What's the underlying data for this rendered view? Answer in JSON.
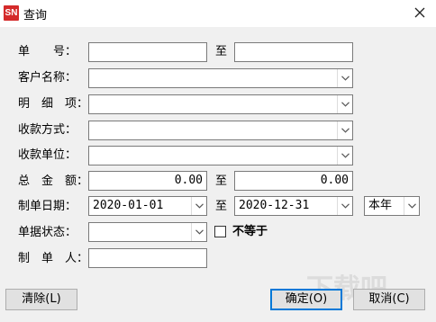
{
  "window": {
    "title": "查询",
    "app_icon_text": "SN"
  },
  "form": {
    "doc_no": {
      "label": "单　　号：",
      "from": "",
      "to_sep": "至",
      "to": ""
    },
    "customer": {
      "label": "客户名称：",
      "value": ""
    },
    "detail_item": {
      "label": "明　细　项：",
      "value": ""
    },
    "payment_method": {
      "label": "收款方式：",
      "value": ""
    },
    "payee_unit": {
      "label": "收款单位：",
      "value": ""
    },
    "total_amount": {
      "label": "总　金　额：",
      "from": "0.00",
      "to_sep": "至",
      "to": "0.00"
    },
    "create_date": {
      "label": "制单日期：",
      "from": "2020-01-01",
      "to_sep": "至",
      "to": "2020-12-31",
      "period": "本年"
    },
    "doc_status": {
      "label": "单据状态：",
      "value": "",
      "not_equal_label": "不等于",
      "not_equal_checked": false
    },
    "creator": {
      "label": "制　单　人：",
      "value": ""
    }
  },
  "buttons": {
    "clear": "清除(L)",
    "ok": "确定(O)",
    "cancel": "取消(C)"
  },
  "watermark": "下载吧"
}
